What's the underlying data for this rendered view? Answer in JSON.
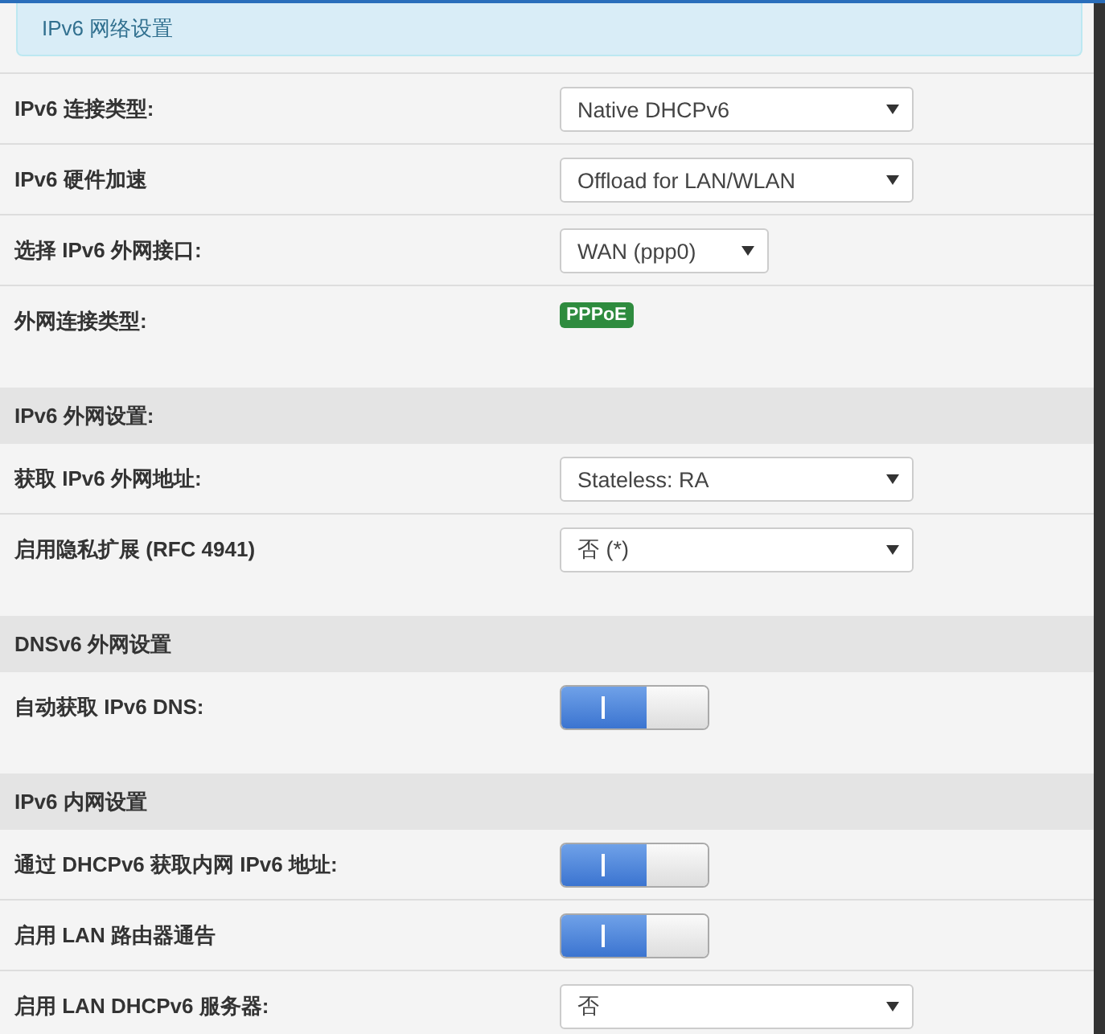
{
  "banner": {
    "title": "IPv6 网络设置"
  },
  "rows": [
    {
      "kind": "select",
      "label": "IPv6 连接类型:",
      "value": "Native DHCPv6"
    },
    {
      "kind": "select",
      "label": "IPv6 硬件加速",
      "value": "Offload for LAN/WLAN"
    },
    {
      "kind": "short-select",
      "label": "选择 IPv6 外网接口:",
      "value": "WAN (ppp0)"
    },
    {
      "kind": "badge",
      "label": "外网连接类型:",
      "value": "PPPoE"
    },
    {
      "kind": "section",
      "label": "IPv6 外网设置:"
    },
    {
      "kind": "select",
      "label": "获取 IPv6 外网地址:",
      "value": "Stateless: RA"
    },
    {
      "kind": "select",
      "label": "启用隐私扩展 (RFC 4941)",
      "value": "否 (*)"
    },
    {
      "kind": "section",
      "label": "DNSv6 外网设置"
    },
    {
      "kind": "toggle",
      "label": "自动获取 IPv6 DNS:",
      "on": true
    },
    {
      "kind": "section",
      "label": "IPv6 内网设置"
    },
    {
      "kind": "toggle",
      "label": "通过 DHCPv6 获取内网 IPv6 地址:",
      "on": true
    },
    {
      "kind": "toggle",
      "label": "启用 LAN 路由器通告",
      "on": true
    },
    {
      "kind": "select",
      "label": "启用 LAN DHCPv6 服务器:",
      "value": "否"
    }
  ]
}
